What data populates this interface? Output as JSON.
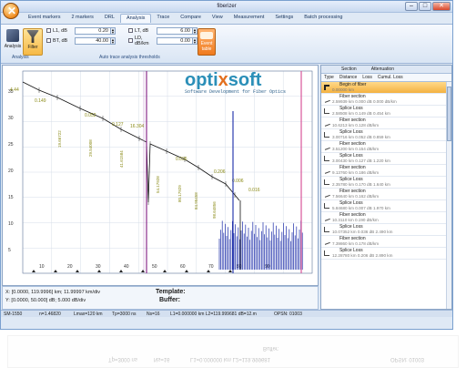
{
  "window": {
    "title": "fiberizer"
  },
  "ribbon": {
    "tabs": [
      "Event markers",
      "2 markers",
      "DRL",
      "Analysis",
      "Trace",
      "Compare",
      "View",
      "Measurement",
      "Settings",
      "Batch processing"
    ],
    "active_tab": "Analysis",
    "analysis_btn": "Analysis",
    "filter_btn": "Filter",
    "event_btn_line1": "Event",
    "event_btn_line2": "table",
    "group_analysis": "Analysis",
    "group_thresholds": "Auto trace analysis thresholds",
    "fields": {
      "l1_label": "L1, dB",
      "l1_value": "0.20",
      "bt_label": "BT, dB",
      "bt_value": "40.00",
      "lt_label": "LT, dB",
      "lt_value": "6.00",
      "lo_label": "LD, dB/km",
      "lo_value": "0.00"
    }
  },
  "logo": {
    "brand_a": "opti",
    "brand_x": "x",
    "brand_b": "soft",
    "tagline": "Software Development for Fiber Optics"
  },
  "plot": {
    "y_ticks": [
      "35",
      "30",
      "25",
      "20",
      "15",
      "10",
      "5"
    ],
    "x_ticks": [
      "10",
      "20",
      "30",
      "40",
      "50",
      "60",
      "70",
      "80",
      "90"
    ],
    "event_labels": [
      "4.44",
      "0.149",
      "0.052",
      "0.127",
      "16.304",
      "0.036",
      "0.206",
      "0.006",
      "0.016"
    ],
    "distance_labels": [
      "19.66722",
      "29.54008",
      "41.61584",
      "54.17928",
      "80.17929",
      "84.95458",
      "98.64856"
    ],
    "trace_color": "#111111",
    "noise_color": "#1a2ba8",
    "marker1_color": "#8b2c8b",
    "marker2_color": "#d8569a"
  },
  "info": {
    "line1": "X: [0.0000, 119.9996] km; 11.99997 km/div",
    "line2": "Y: [0.0000, 50.000] dB; 5.000 dB/div",
    "template": "Template:",
    "buffer": "Buffer:"
  },
  "status": {
    "s1": "SM-1550",
    "s2": "n=1.46820",
    "s3": "Lmax=120 km",
    "s4": "Tp=3000 ns",
    "s5": "Ns=16",
    "s6": "L1=0.000000 km L2=119.999681 dB=12.m",
    "s7": "OPSN: 01003"
  },
  "events": {
    "sections": [
      "Section",
      "Attenuation"
    ],
    "columns": [
      "Type",
      "Distance",
      "Loss",
      "Cumul. Loss"
    ],
    "rows": [
      {
        "name": "Begin of fiber",
        "val": "0.00000 km",
        "sel": true,
        "kind": "begin"
      },
      {
        "name": "Fiber section",
        "val": "2.59939 km   0.000 dB   0.000 dB/km",
        "kind": "section"
      },
      {
        "name": "Splice Loss",
        "val": "2.58508 km   0.149 dB   0.454 km",
        "kind": "splice"
      },
      {
        "name": "Fiber section",
        "val": "10.6213 km   0.128 dB/km",
        "kind": "section"
      },
      {
        "name": "Splice Loss",
        "val": "3.00716 km   0.052 dB   0.859 km",
        "kind": "splice"
      },
      {
        "name": "Fiber section",
        "val": "3.51200 km   0.154 dB/km",
        "kind": "section"
      },
      {
        "name": "Splice Loss",
        "val": "3.00430 km   0.127 dB   1.220 km",
        "kind": "splice"
      },
      {
        "name": "Fiber section",
        "val": "9.13760 km   0.186 dB/km",
        "kind": "section"
      },
      {
        "name": "Splice Loss",
        "val": "2.35780 km   0.170 dB   1.640 km",
        "kind": "splice"
      },
      {
        "name": "Fiber section",
        "val": "7.56640 km   0.162 dB/km",
        "kind": "section"
      },
      {
        "name": "Splice Loss",
        "val": "5.84680 km   0.007 dB   1.970 km",
        "kind": "splice"
      },
      {
        "name": "Fiber section",
        "val": "10.3110 km   0.190 dB/km",
        "kind": "section"
      },
      {
        "name": "Splice Loss",
        "val": "10.07352 km   0.036 dB   2.490 km",
        "kind": "splice"
      },
      {
        "name": "Fiber section",
        "val": "7.39860 km   0.178 dB/km",
        "kind": "section"
      },
      {
        "name": "Splice Loss",
        "val": "12.28780 km   0.206 dB   2.890 km",
        "kind": "splice"
      }
    ]
  },
  "echo": {
    "a": "Buffer:",
    "b": "Tp=3000 ns",
    "c": "Ns=16",
    "d": "L1=0.000000 km L2=119.999681",
    "e": "OPSN: 01003"
  }
}
